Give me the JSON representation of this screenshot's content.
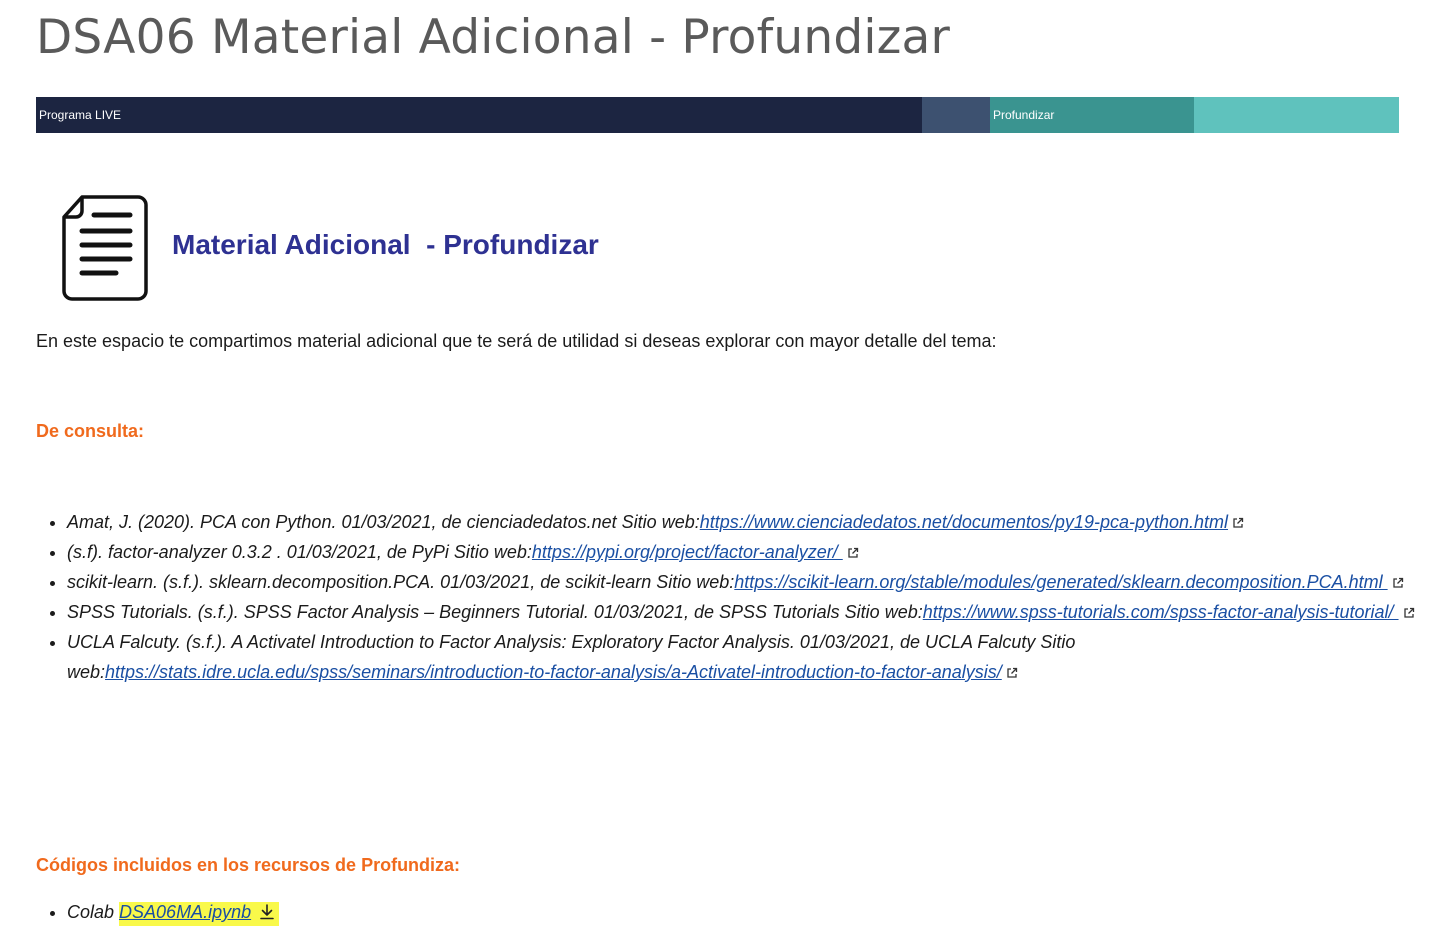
{
  "page": {
    "title": "DSA06 Material Adicional - Profundizar"
  },
  "progress": {
    "live_label": "Programa LIVE",
    "mid_label": "",
    "profundizar_label": "Profundizar",
    "end_label": "",
    "colors": {
      "live": "#1c2541",
      "mid": "#3d5170",
      "profundizar": "#3a9490",
      "end": "#5fc2bd"
    }
  },
  "content": {
    "icon": "document-lines-icon",
    "heading": "Material Adicional  - Profundizar",
    "intro": "En este espacio te compartimos material adicional que te será de utilidad si deseas explorar con mayor detalle del tema:",
    "consulta_heading": "De consulta:",
    "references": [
      {
        "text": "Amat, J. (2020). PCA con Python. 01/03/2021, de cienciadedatos.net Sitio web:",
        "link": "https://www.cienciadedatos.net/documentos/py19-pca-python.html"
      },
      {
        "text": "(s.f). factor-analyzer 0.3.2 . 01/03/2021, de PyPi Sitio web:",
        "link": "https://pypi.org/project/factor-analyzer/ "
      },
      {
        "text": "scikit-learn. (s.f.). sklearn.decomposition.PCA. 01/03/2021, de scikit-learn Sitio web:",
        "link": "https://scikit-learn.org/stable/modules/generated/sklearn.decomposition.PCA.html "
      },
      {
        "text": "SPSS Tutorials. (s.f.). SPSS Factor Analysis – Beginners Tutorial. 01/03/2021, de SPSS Tutorials Sitio web:",
        "link": "https://www.spss-tutorials.com/spss-factor-analysis-tutorial/ "
      },
      {
        "text": "UCLA Falcuty. (s.f.). A Activatel Introduction to Factor Analysis: Exploratory Factor Analysis. 01/03/2021, de UCLA Falcuty Sitio web:",
        "link": "https://stats.idre.ucla.edu/spss/seminars/introduction-to-factor-analysis/a-Activatel-introduction-to-factor-analysis/"
      }
    ],
    "codes_heading": "Códigos incluidos en los recursos de Profundiza:",
    "codes": [
      {
        "prefix": "Colab ",
        "file": "DSA06MA.ipynb"
      }
    ],
    "highlight_color": "#f9f94a"
  }
}
